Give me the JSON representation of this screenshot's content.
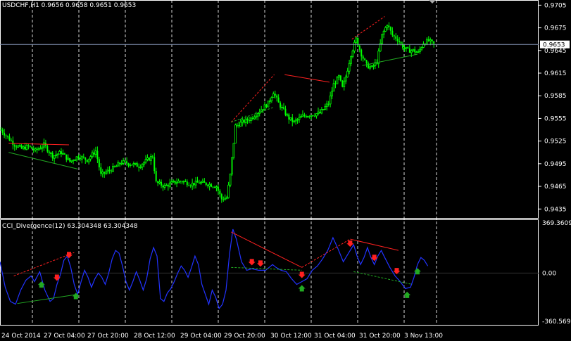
{
  "main_panel": {
    "symbol_info": "USDCHF,H1  0.9656 0.9658 0.9651 0.9653",
    "current_price": "0.9653",
    "price_ticks": [
      "0.9705",
      "0.9675",
      "0.9645",
      "0.9615",
      "0.9585",
      "0.9555",
      "0.9525",
      "0.9495",
      "0.9465",
      "0.9435"
    ]
  },
  "indicator_panel": {
    "title": "CCI_Divergence(12) 63.304348 63.304348",
    "ticks": [
      "369.3609",
      "0.00",
      "-360.569"
    ]
  },
  "time_axis": {
    "labels": [
      "24 Oct 2014",
      "27 Oct 04:00",
      "27 Oct 20:00",
      "28 Oct 12:00",
      "29 Oct 04:00",
      "29 Oct 20:00",
      "30 Oct 12:00",
      "31 Oct 04:00",
      "31 Oct 20:00",
      "3 Nov 13:00"
    ]
  },
  "colors": {
    "background": "#000000",
    "candles": "#00ff00",
    "cci_line": "#2233ff",
    "bearish_divergence": "#ff2020",
    "bullish_divergence": "#22aa22",
    "grid": "#ffffff",
    "price_line": "#8899bb"
  },
  "chart_data": [
    {
      "type": "candlestick",
      "title": "USDCHF,H1",
      "ylim": [
        0.9425,
        0.971
      ],
      "y_ticks": [
        0.9705,
        0.9675,
        0.9645,
        0.9615,
        0.9585,
        0.9555,
        0.9525,
        0.9495,
        0.9465,
        0.9435
      ],
      "current_price": 0.9653,
      "close_path": [
        [
          0,
          0.954
        ],
        [
          4,
          0.953
        ],
        [
          8,
          0.952
        ],
        [
          12,
          0.9515
        ],
        [
          16,
          0.9518
        ],
        [
          20,
          0.9512
        ],
        [
          25,
          0.952
        ],
        [
          30,
          0.9505
        ],
        [
          35,
          0.951
        ],
        [
          40,
          0.9498
        ],
        [
          45,
          0.9505
        ],
        [
          50,
          0.95
        ],
        [
          55,
          0.9512
        ],
        [
          58,
          0.948
        ],
        [
          62,
          0.9485
        ],
        [
          66,
          0.949
        ],
        [
          70,
          0.9497
        ],
        [
          75,
          0.9495
        ],
        [
          80,
          0.9492
        ],
        [
          85,
          0.95
        ],
        [
          88,
          0.9505
        ],
        [
          90,
          0.947
        ],
        [
          95,
          0.9465
        ],
        [
          100,
          0.947
        ],
        [
          105,
          0.9472
        ],
        [
          110,
          0.9468
        ],
        [
          115,
          0.947
        ],
        [
          120,
          0.9468
        ],
        [
          125,
          0.9465
        ],
        [
          128,
          0.9448
        ],
        [
          131,
          0.945
        ],
        [
          133,
          0.948
        ],
        [
          136,
          0.9545
        ],
        [
          140,
          0.955
        ],
        [
          145,
          0.9555
        ],
        [
          150,
          0.9565
        ],
        [
          155,
          0.9575
        ],
        [
          158,
          0.959
        ],
        [
          161,
          0.9575
        ],
        [
          164,
          0.9565
        ],
        [
          167,
          0.9555
        ],
        [
          170,
          0.955
        ],
        [
          175,
          0.9558
        ],
        [
          180,
          0.956
        ],
        [
          185,
          0.9562
        ],
        [
          190,
          0.9575
        ],
        [
          193,
          0.96
        ],
        [
          196,
          0.961
        ],
        [
          198,
          0.9595
        ],
        [
          200,
          0.961
        ],
        [
          203,
          0.964
        ],
        [
          206,
          0.966
        ],
        [
          209,
          0.964
        ],
        [
          212,
          0.9625
        ],
        [
          215,
          0.9622
        ],
        [
          218,
          0.963
        ],
        [
          221,
          0.9665
        ],
        [
          224,
          0.968
        ],
        [
          227,
          0.9665
        ],
        [
          230,
          0.966
        ],
        [
          233,
          0.965
        ],
        [
          236,
          0.9645
        ],
        [
          239,
          0.9645
        ],
        [
          242,
          0.9642
        ],
        [
          245,
          0.9655
        ],
        [
          248,
          0.9658
        ],
        [
          251,
          0.9653
        ]
      ],
      "bearish_divergence_lines": [
        [
          [
            5,
            0.9522
          ],
          [
            40,
            0.952
          ]
        ],
        [
          [
            134,
            0.955
          ],
          [
            159,
            0.9613
          ]
        ],
        [
          [
            165,
            0.9613
          ],
          [
            191,
            0.9603
          ]
        ],
        [
          [
            204,
            0.966
          ],
          [
            223,
            0.969
          ]
        ]
      ],
      "bullish_divergence_lines": [
        [
          [
            5,
            0.951
          ],
          [
            45,
            0.9488
          ]
        ],
        [
          [
            134,
            0.955
          ],
          [
            159,
            0.957
          ]
        ],
        [
          [
            210,
            0.9625
          ],
          [
            242,
            0.964
          ]
        ]
      ]
    },
    {
      "type": "line",
      "title": "CCI_Divergence(12) 63.304348 63.304348",
      "ylim": [
        -360.569,
        369.3609
      ],
      "y_ticks": [
        369.3609,
        0.0,
        -360.569
      ],
      "series": [
        {
          "name": "CCI_Divergence(12)",
          "points": [
            [
              0,
              80
            ],
            [
              3,
              -100
            ],
            [
              6,
              -200
            ],
            [
              9,
              -220
            ],
            [
              12,
              -120
            ],
            [
              15,
              -50
            ],
            [
              18,
              -20
            ],
            [
              20,
              -60
            ],
            [
              23,
              10
            ],
            [
              26,
              -120
            ],
            [
              29,
              -200
            ],
            [
              31,
              -180
            ],
            [
              33,
              -80
            ],
            [
              35,
              -10
            ],
            [
              37,
              90
            ],
            [
              39,
              120
            ],
            [
              41,
              40
            ],
            [
              43,
              -80
            ],
            [
              45,
              -150
            ],
            [
              47,
              -60
            ],
            [
              49,
              20
            ],
            [
              51,
              -30
            ],
            [
              53,
              -100
            ],
            [
              55,
              -40
            ],
            [
              57,
              0
            ],
            [
              59,
              -30
            ],
            [
              61,
              -80
            ],
            [
              63,
              0
            ],
            [
              65,
              100
            ],
            [
              67,
              160
            ],
            [
              69,
              140
            ],
            [
              71,
              50
            ],
            [
              73,
              -60
            ],
            [
              75,
              -120
            ],
            [
              77,
              -60
            ],
            [
              79,
              10
            ],
            [
              81,
              -50
            ],
            [
              83,
              -120
            ],
            [
              85,
              -40
            ],
            [
              87,
              100
            ],
            [
              89,
              180
            ],
            [
              91,
              120
            ],
            [
              93,
              -180
            ],
            [
              95,
              -200
            ],
            [
              97,
              -140
            ],
            [
              99,
              -110
            ],
            [
              101,
              -60
            ],
            [
              103,
              0
            ],
            [
              105,
              50
            ],
            [
              107,
              20
            ],
            [
              109,
              -30
            ],
            [
              111,
              40
            ],
            [
              113,
              120
            ],
            [
              115,
              60
            ],
            [
              117,
              -80
            ],
            [
              119,
              -150
            ],
            [
              121,
              -220
            ],
            [
              123,
              -120
            ],
            [
              125,
              -170
            ],
            [
              127,
              -250
            ],
            [
              129,
              -220
            ],
            [
              131,
              -120
            ],
            [
              133,
              130
            ],
            [
              135,
              310
            ],
            [
              137,
              240
            ],
            [
              140,
              80
            ],
            [
              143,
              20
            ],
            [
              146,
              30
            ],
            [
              150,
              20
            ],
            [
              154,
              20
            ],
            [
              158,
              60
            ],
            [
              160,
              40
            ],
            [
              163,
              20
            ],
            [
              166,
              10
            ],
            [
              169,
              -40
            ],
            [
              172,
              -80
            ],
            [
              175,
              -60
            ],
            [
              178,
              -40
            ],
            [
              181,
              20
            ],
            [
              184,
              50
            ],
            [
              187,
              100
            ],
            [
              190,
              160
            ],
            [
              193,
              250
            ],
            [
              196,
              170
            ],
            [
              199,
              80
            ],
            [
              202,
              140
            ],
            [
              205,
              200
            ],
            [
              207,
              120
            ],
            [
              209,
              60
            ],
            [
              211,
              110
            ],
            [
              213,
              180
            ],
            [
              215,
              110
            ],
            [
              217,
              60
            ],
            [
              219,
              120
            ],
            [
              221,
              160
            ],
            [
              223,
              110
            ],
            [
              226,
              40
            ],
            [
              229,
              -20
            ],
            [
              232,
              -60
            ],
            [
              235,
              -110
            ],
            [
              238,
              -100
            ],
            [
              240,
              -30
            ],
            [
              242,
              60
            ],
            [
              244,
              110
            ],
            [
              246,
              90
            ],
            [
              248,
              50
            ]
          ]
        }
      ],
      "bearish_divergence_lines": [
        [
          [
            8,
            -20
          ],
          [
            43,
            145
          ]
        ],
        [
          [
            134,
            290
          ],
          [
            175,
            40
          ]
        ],
        [
          [
            175,
            40
          ],
          [
            203,
            240
          ]
        ],
        [
          [
            203,
            240
          ],
          [
            231,
            160
          ]
        ]
      ],
      "bullish_divergence_lines": [
        [
          [
            10,
            -215
          ],
          [
            45,
            -150
          ]
        ],
        [
          [
            134,
            40
          ],
          [
            175,
            20
          ]
        ],
        [
          [
            205,
            10
          ],
          [
            239,
            -80
          ]
        ]
      ],
      "sell_arrows_at": [
        40,
        33,
        146,
        151,
        175,
        203,
        217,
        230
      ],
      "buy_arrows_at": [
        24,
        44,
        175,
        236,
        242
      ]
    }
  ]
}
